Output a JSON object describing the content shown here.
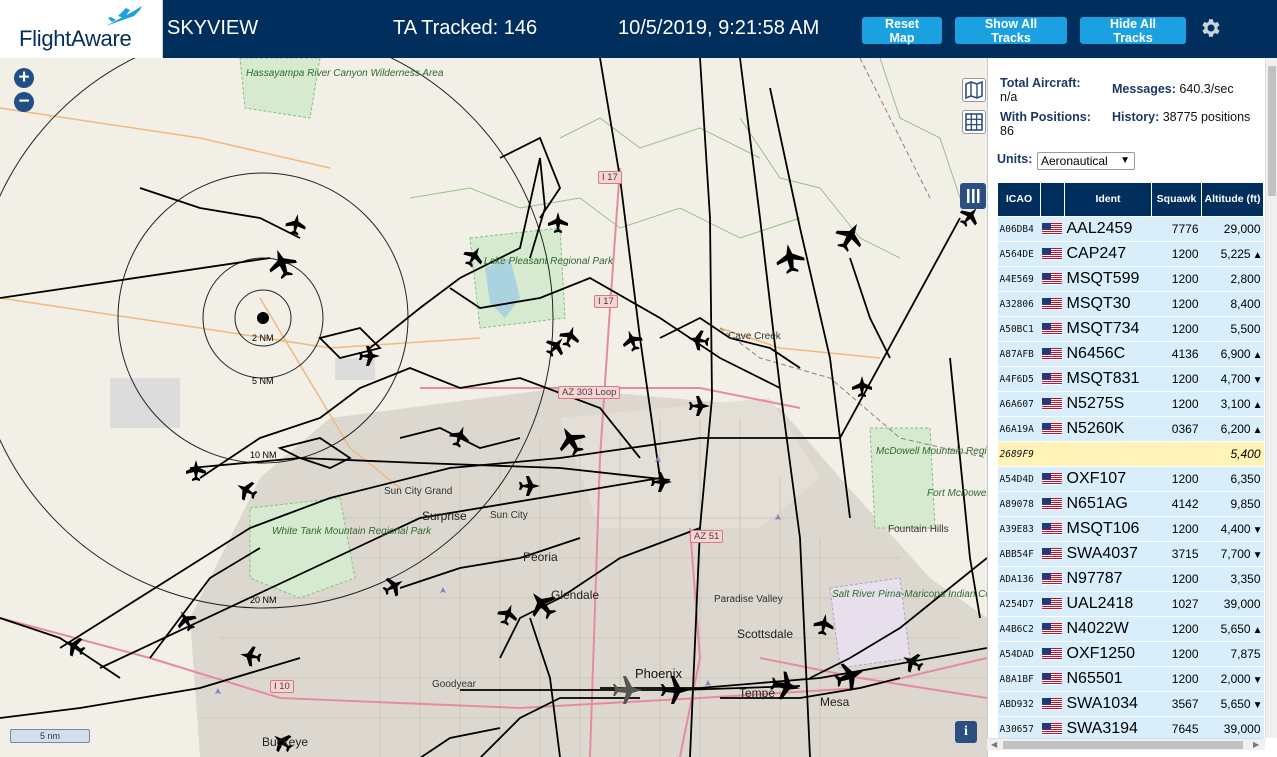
{
  "header": {
    "logo_text": "FlightAware",
    "site_name": "SKYVIEW",
    "ta_tracked": "TA Tracked: 146",
    "clock": "10/5/2019, 9:21:58 AM",
    "buttons": {
      "reset": "Reset Map",
      "show_all": "Show All Tracks",
      "hide_all": "Hide All Tracks"
    },
    "settings_icon": "gear-icon"
  },
  "map": {
    "zoom_in": "+",
    "zoom_out": "−",
    "scale_label": "5 nm",
    "info_label": "i",
    "ring_labels": [
      "2 NM",
      "5 NM",
      "10 NM",
      "20 NM"
    ],
    "places": {
      "hassayampa": "Hassayampa River Canyon Wilderness Area",
      "lake_pleasant": "Lake Pleasant Regional Park",
      "cave_creek": "Cave Creek",
      "mcdowell": "McDowell Mountain Regional Park",
      "fort_mcdowell": "Fort McDowell Yavapai Nation",
      "fountain_hills": "Fountain Hills",
      "sun_city_grand": "Sun City Grand",
      "surprise": "Surprise",
      "sun_city": "Sun City",
      "white_tank": "White Tank Mountain Regional Park",
      "peoria": "Peoria",
      "glendale": "Glendale",
      "paradise_valley": "Paradise Valley",
      "scottsdale": "Scottsdale",
      "salt_river": "Salt River Pima-Maricopa Indian Community",
      "phoenix": "Phoenix",
      "tempe": "Tempe",
      "mesa": "Mesa",
      "goodyear": "Goodyear",
      "buckeye": "Buckeye"
    },
    "shields": {
      "i17_north": "I 17",
      "i17_mid": "I 17",
      "az303": "AZ 303 Loop",
      "az51": "AZ 51",
      "i10": "I 10"
    },
    "colors": {
      "land": "#f1efe6",
      "park": "#d6ead0",
      "urban": "#ddd8cf",
      "track": "#000000"
    }
  },
  "sidebar": {
    "stats": {
      "total_label": "Total Aircraft:",
      "total_value": "n/a",
      "messages_label": "Messages:",
      "messages_value": "640.3/sec",
      "positions_label": "With Positions:",
      "positions_value": "86",
      "history_label": "History:",
      "history_value": "38775 positions"
    },
    "units_label": "Units:",
    "units_value": "Aeronautical",
    "table": {
      "headers": {
        "icao": "ICAO",
        "ident": "Ident",
        "squawk": "Squawk",
        "altitude": "Altitude (ft)"
      },
      "rows": [
        {
          "icao": "A06DB4",
          "ident": "AAL2459",
          "squawk": "7776",
          "alt": "29,000",
          "trend": ""
        },
        {
          "icao": "A564DE",
          "ident": "CAP247",
          "squawk": "1200",
          "alt": "5,225",
          "trend": "▲"
        },
        {
          "icao": "A4E569",
          "ident": "MSQT599",
          "squawk": "1200",
          "alt": "2,800",
          "trend": ""
        },
        {
          "icao": "A32806",
          "ident": "MSQT30",
          "squawk": "1200",
          "alt": "8,400",
          "trend": ""
        },
        {
          "icao": "A50BC1",
          "ident": "MSQT734",
          "squawk": "1200",
          "alt": "5,500",
          "trend": ""
        },
        {
          "icao": "A87AFB",
          "ident": "N6456C",
          "squawk": "4136",
          "alt": "6,900",
          "trend": "▲"
        },
        {
          "icao": "A4F6D5",
          "ident": "MSQT831",
          "squawk": "1200",
          "alt": "4,700",
          "trend": "▼"
        },
        {
          "icao": "A6A607",
          "ident": "N5275S",
          "squawk": "1200",
          "alt": "3,100",
          "trend": "▲"
        },
        {
          "icao": "A6A19A",
          "ident": "N5260K",
          "squawk": "0367",
          "alt": "6,200",
          "trend": "▲"
        },
        {
          "icao": "2689F9",
          "ident": "",
          "squawk": "",
          "alt": "5,400",
          "trend": "",
          "highlight": true,
          "noflag": true
        },
        {
          "icao": "A54D4D",
          "ident": "OXF107",
          "squawk": "1200",
          "alt": "6,350",
          "trend": ""
        },
        {
          "icao": "A89078",
          "ident": "N651AG",
          "squawk": "4142",
          "alt": "9,850",
          "trend": ""
        },
        {
          "icao": "A39E83",
          "ident": "MSQT106",
          "squawk": "1200",
          "alt": "4,400",
          "trend": "▼"
        },
        {
          "icao": "ABB54F",
          "ident": "SWA4037",
          "squawk": "3715",
          "alt": "7,700",
          "trend": "▼"
        },
        {
          "icao": "ADA136",
          "ident": "N97787",
          "squawk": "1200",
          "alt": "3,350",
          "trend": ""
        },
        {
          "icao": "A254D7",
          "ident": "UAL2418",
          "squawk": "1027",
          "alt": "39,000",
          "trend": ""
        },
        {
          "icao": "A4B6C2",
          "ident": "N4022W",
          "squawk": "1200",
          "alt": "5,650",
          "trend": "▲"
        },
        {
          "icao": "A54DAD",
          "ident": "OXF1250",
          "squawk": "1200",
          "alt": "7,875",
          "trend": ""
        },
        {
          "icao": "A8A1BF",
          "ident": "N65501",
          "squawk": "1200",
          "alt": "2,000",
          "trend": "▼"
        },
        {
          "icao": "ABD932",
          "ident": "SWA1034",
          "squawk": "3567",
          "alt": "5,650",
          "trend": "▼"
        },
        {
          "icao": "A30657",
          "ident": "SWA3194",
          "squawk": "7645",
          "alt": "39,000",
          "trend": ""
        }
      ]
    }
  }
}
